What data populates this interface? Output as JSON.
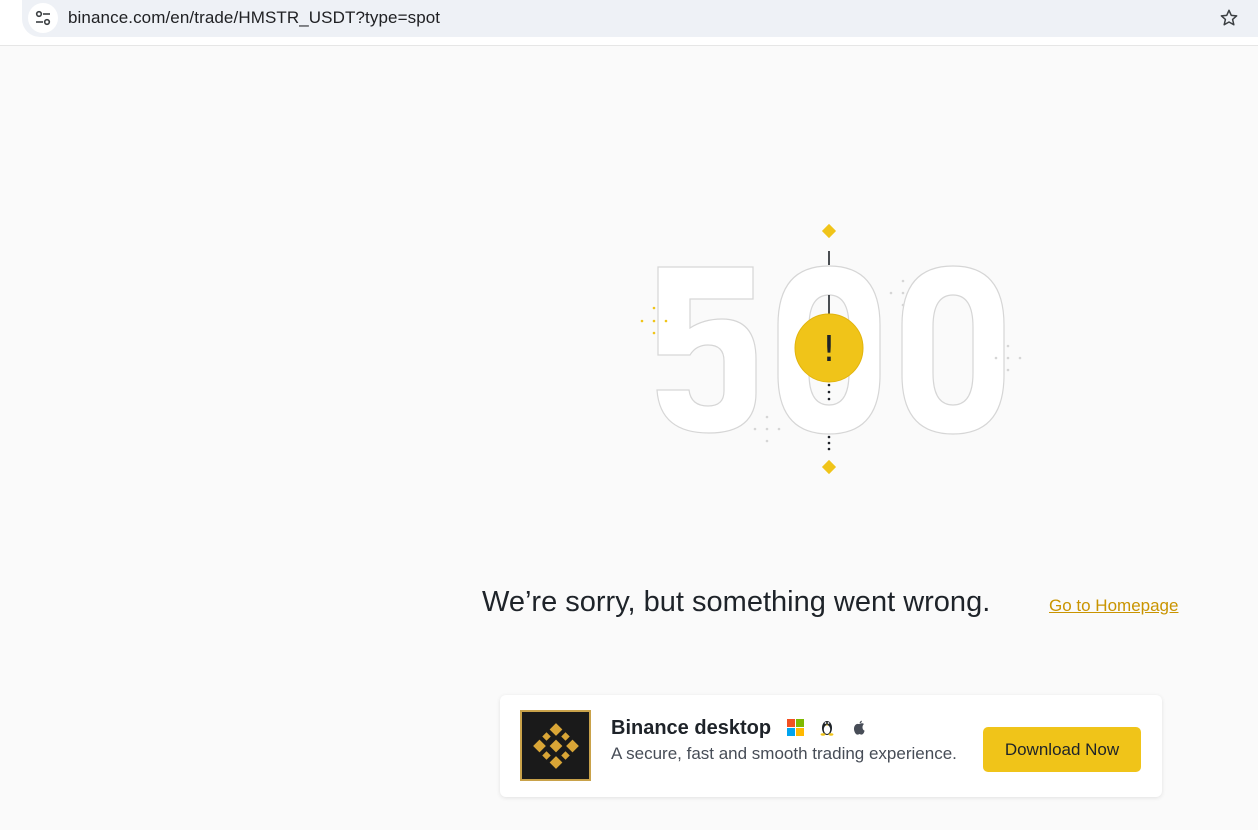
{
  "browser": {
    "url": "binance.com/en/trade/HMSTR_USDT?type=spot",
    "site_info_icon": "tune-icon",
    "bookmark_icon": "star-outline-icon"
  },
  "error": {
    "code": "500",
    "badge_symbol": "!",
    "message": "We’re sorry, but something went wrong.",
    "link_text": "Go to Homepage"
  },
  "download_card": {
    "title": "Binance desktop",
    "subtitle": "A secure, fast and smooth trading experience.",
    "button_label": "Download Now",
    "os_icons": [
      "windows-icon",
      "linux-icon",
      "apple-icon"
    ]
  },
  "colors": {
    "accent": "#F0C419",
    "link": "#C99400",
    "text": "#1E2329",
    "background": "#FAFAFA"
  }
}
